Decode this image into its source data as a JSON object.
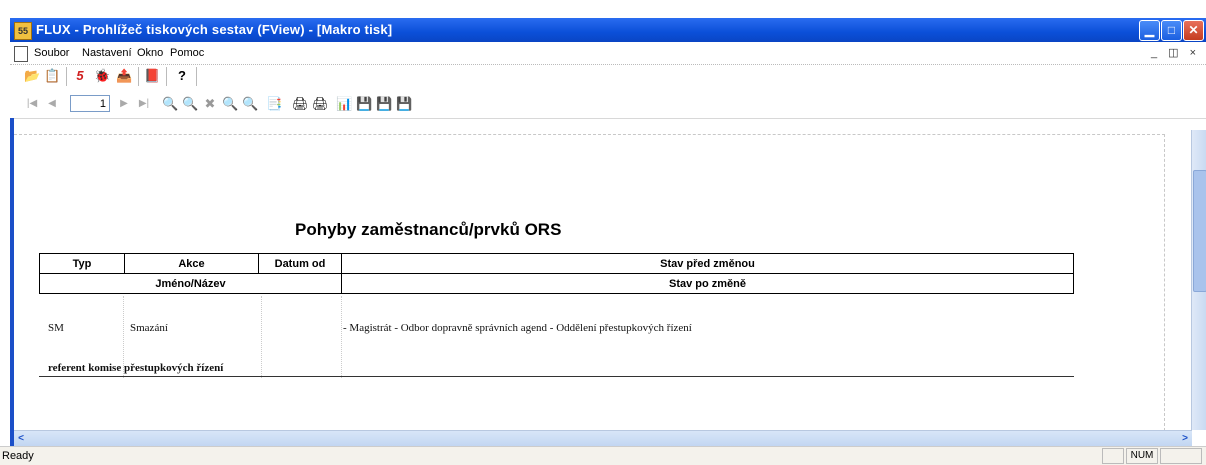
{
  "window": {
    "icon_text": "55",
    "title": "FLUX - Prohlížeč tiskových sestav (FView) - [Makro tisk]",
    "buttons": {
      "minimize": "▁",
      "maximize": "□",
      "close": "✕"
    }
  },
  "menu": {
    "items": [
      "Soubor",
      "Nastavení",
      "Okno",
      "Pomoc"
    ],
    "mdi_controls": "_ ◫ ×"
  },
  "toolbar1": {
    "icons": [
      "open-folder-icon",
      "properties-icon",
      "macro-5-icon",
      "bug-icon",
      "export-icon",
      "book-icon",
      "help-icon"
    ],
    "glyphs": [
      "📂",
      "📋",
      "5",
      "🐞",
      "📤",
      "📕",
      "?"
    ]
  },
  "toolbar2": {
    "nav": [
      "|◀",
      "◀",
      "▶",
      "▶|"
    ],
    "page_number": "1",
    "zoom_glyphs": [
      "🔍",
      "🔍",
      "✖",
      "🔍",
      "🔍",
      "📑",
      "🖨",
      "🖨",
      "📊",
      "💾",
      "💾",
      "💾"
    ]
  },
  "report": {
    "title": "Pohyby zaměstnanců/prvků ORS",
    "header_row1": [
      "Typ",
      "Akce",
      "Datum od",
      "Stav před změnou"
    ],
    "header_row2": [
      "Jméno/Název",
      "Stav po změně"
    ],
    "row": {
      "typ": "SM",
      "akce": "Smazání",
      "stav_pred": "- Magistrát - Odbor dopravně správních agend - Oddělení přestupkových řízení",
      "jmeno": "referent komise přestupkových řízení"
    }
  },
  "scroll": {
    "h_left": "<",
    "h_right": ">"
  },
  "status": {
    "text": "Ready",
    "num": "NUM"
  },
  "colors": {
    "titlebar": "#0b4fd8",
    "frame": "#1b4fc8"
  }
}
